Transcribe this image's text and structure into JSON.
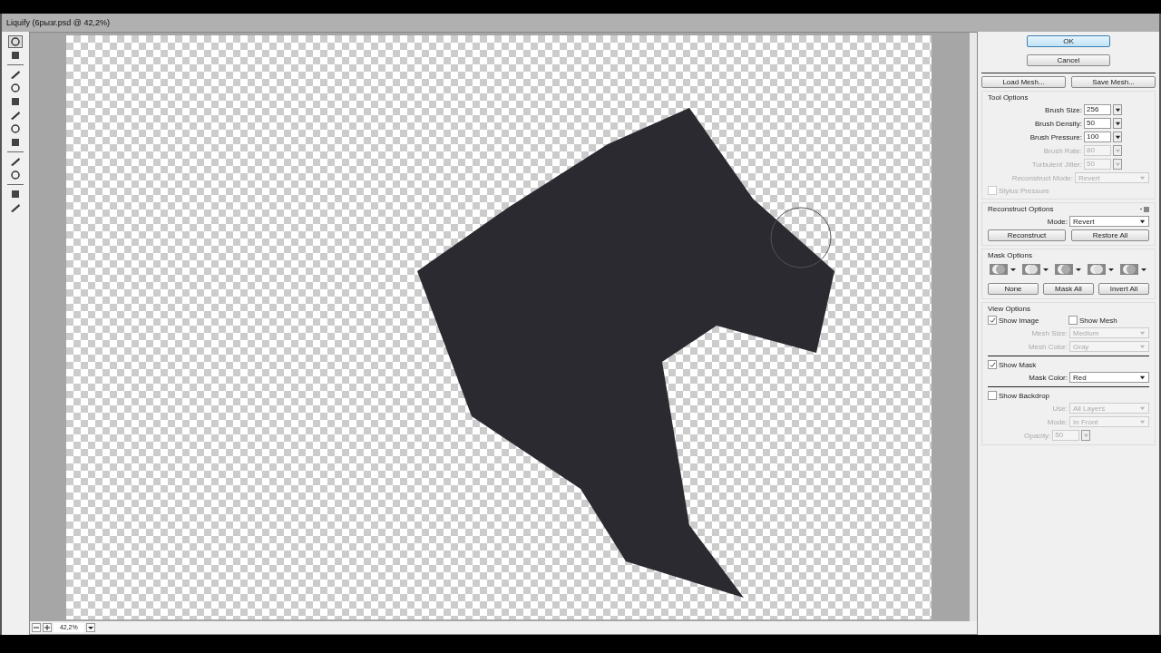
{
  "window": {
    "title": "Liquify (6рызг.psd @ 42,2%)"
  },
  "tools": [
    {
      "selected": true
    },
    {
      "selected": false
    },
    {
      "selected": false
    },
    {
      "selected": false
    },
    {
      "selected": false
    },
    {
      "selected": false
    },
    {
      "selected": false
    },
    {
      "selected": false
    },
    {
      "selected": false
    },
    {
      "selected": false
    },
    {
      "selected": false
    },
    {
      "selected": false
    }
  ],
  "zoom": {
    "value": "42,2%"
  },
  "dialog_buttons": [
    {
      "label": "OK",
      "default": true
    },
    {
      "label": "Cancel",
      "default": false
    }
  ],
  "mesh_buttons": [
    "Load Mesh...",
    "Save Mesh..."
  ],
  "tool_options": {
    "title": "Tool Options",
    "fields": [
      {
        "kind": "combo",
        "label": "Brush Size:",
        "value": "256",
        "disabled": false
      },
      {
        "kind": "combo",
        "label": "Brush Density:",
        "value": "50",
        "disabled": false
      },
      {
        "kind": "combo",
        "label": "Brush Pressure:",
        "value": "100",
        "disabled": false
      },
      {
        "kind": "combo",
        "label": "Brush Rate:",
        "value": "80",
        "disabled": true
      },
      {
        "kind": "combo",
        "label": "Turbulent Jitter:",
        "value": "50",
        "disabled": true
      },
      {
        "kind": "select",
        "label": "Reconstruct Mode:",
        "value": "Revert",
        "disabled": true
      }
    ],
    "stylus": {
      "label": "Stylus Pressure",
      "checked": false,
      "disabled": true
    }
  },
  "reconstruct_options": {
    "title": "Reconstruct Options",
    "mode": {
      "label": "Mode:",
      "value": "Revert"
    },
    "buttons": [
      "Reconstruct",
      "Restore All"
    ]
  },
  "mask_options": {
    "title": "Mask Options",
    "modes": [
      {
        "selected": false
      },
      {
        "selected": false
      },
      {
        "selected": false
      },
      {
        "selected": false
      },
      {
        "selected": false
      }
    ],
    "buttons": [
      "None",
      "Mask All",
      "Invert All"
    ]
  },
  "view_options": {
    "title": "View Options",
    "rows": [
      {
        "kind": "checkpair",
        "items": [
          {
            "label": "Show Image",
            "checked": true
          },
          {
            "label": "Show Mesh",
            "checked": false
          }
        ]
      },
      {
        "kind": "select",
        "label": "Mesh Size:",
        "value": "Medium",
        "disabled": true
      },
      {
        "kind": "select",
        "label": "Mesh Color:",
        "value": "Gray",
        "disabled": true
      },
      {
        "kind": "divider"
      },
      {
        "kind": "check",
        "label": "Show Mask",
        "checked": true
      },
      {
        "kind": "select",
        "label": "Mask Color:",
        "value": "Red",
        "disabled": false
      },
      {
        "kind": "divider"
      },
      {
        "kind": "check",
        "label": "Show Backdrop",
        "checked": false
      },
      {
        "kind": "select",
        "label": "Use:",
        "value": "All Layers",
        "disabled": true
      },
      {
        "kind": "select",
        "label": "Mode:",
        "value": "In Front",
        "disabled": true
      },
      {
        "kind": "combo",
        "label": "Opacity:",
        "value": "50",
        "disabled": true
      }
    ]
  }
}
